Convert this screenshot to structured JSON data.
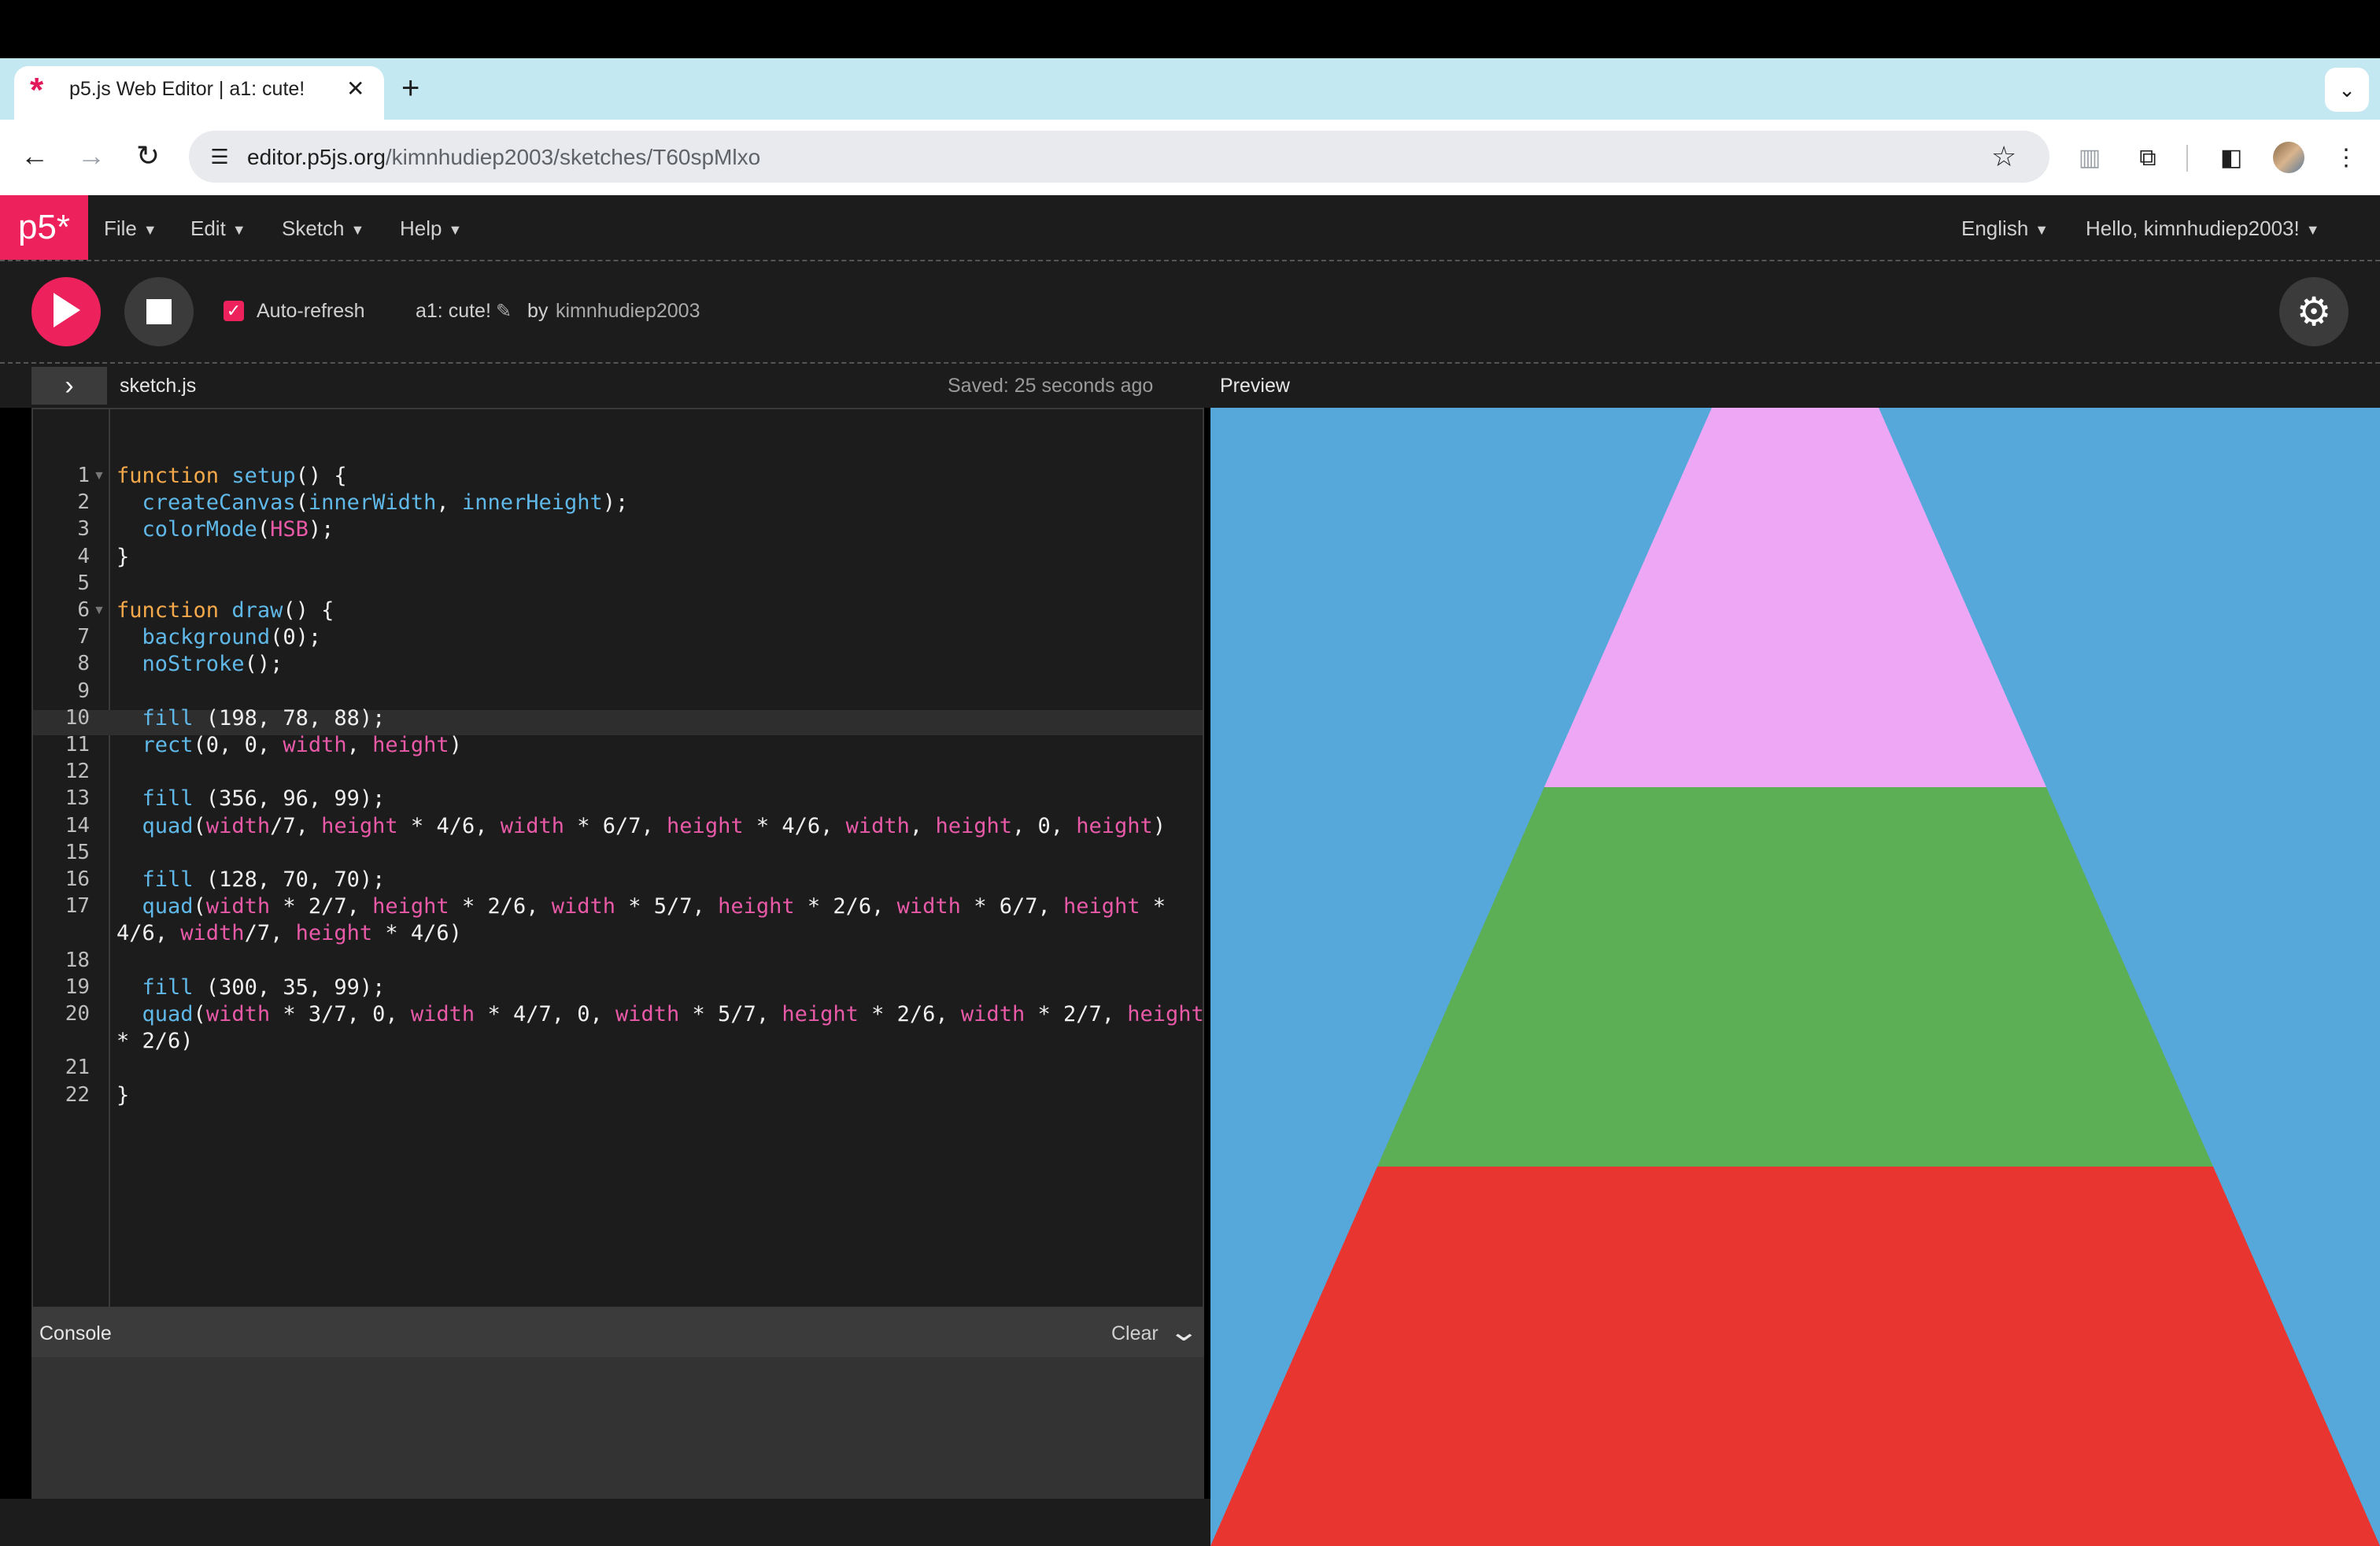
{
  "browser": {
    "tab_title": "p5.js Web Editor | a1: cute!",
    "tab_close": "✕",
    "new_tab": "+",
    "tab_menu": "⌄",
    "url_host": "editor.p5js.org",
    "url_path": "/kimnhudiep2003/sketches/T60spMlxo",
    "nav_back": "←",
    "nav_forward": "→",
    "nav_reload": "↻",
    "star": "☆",
    "more": "⋮"
  },
  "p5": {
    "logo": "p5*",
    "menus": [
      "File",
      "Edit",
      "Sketch",
      "Help"
    ],
    "language": "English",
    "user_greeting": "Hello, kimnhudiep2003!",
    "auto_refresh_label": "Auto-refresh",
    "auto_refresh_checked": true,
    "sketch_name": "a1: cute!",
    "by_label": "by",
    "author": "kimnhudiep2003",
    "file_name": "sketch.js",
    "saved_status": "Saved: 25 seconds ago",
    "preview_label": "Preview",
    "console_label": "Console",
    "console_clear": "Clear",
    "accent": "#ed225d"
  },
  "code": {
    "line_numbers": [
      "1",
      "2",
      "3",
      "4",
      "5",
      "6",
      "7",
      "8",
      "9",
      "10",
      "11",
      "12",
      "13",
      "14",
      "15",
      "16",
      "17",
      "18",
      "19",
      "20",
      "21",
      "22"
    ],
    "lines": [
      "function setup() {",
      "  createCanvas(innerWidth, innerHeight);",
      "  colorMode(HSB);",
      "}",
      "",
      "function draw() {",
      "  background(0);",
      "  noStroke();",
      "",
      "  fill (198, 78, 88);",
      "  rect(0, 0, width, height)",
      "",
      "  fill (356, 96, 99);",
      "  quad(width/7, height * 4/6, width * 6/7, height * 4/6, width, height, 0, height)",
      "",
      "  fill (128, 70, 70);",
      "  quad(width * 2/7, height * 2/6, width * 5/7, height * 2/6, width * 6/7, height *",
      "4/6, width/7, height * 4/6)",
      "",
      "  fill (300, 35, 99);",
      "  quad(width * 3/7, 0, width * 4/7, 0, width * 5/7, height * 2/6, width * 2/7, height",
      "* 2/6)",
      "",
      "}"
    ]
  },
  "preview_colors": {
    "background": "#57a8da",
    "bottom": "#e8352f",
    "middle": "#5caf55",
    "top": "#eea7f5"
  }
}
